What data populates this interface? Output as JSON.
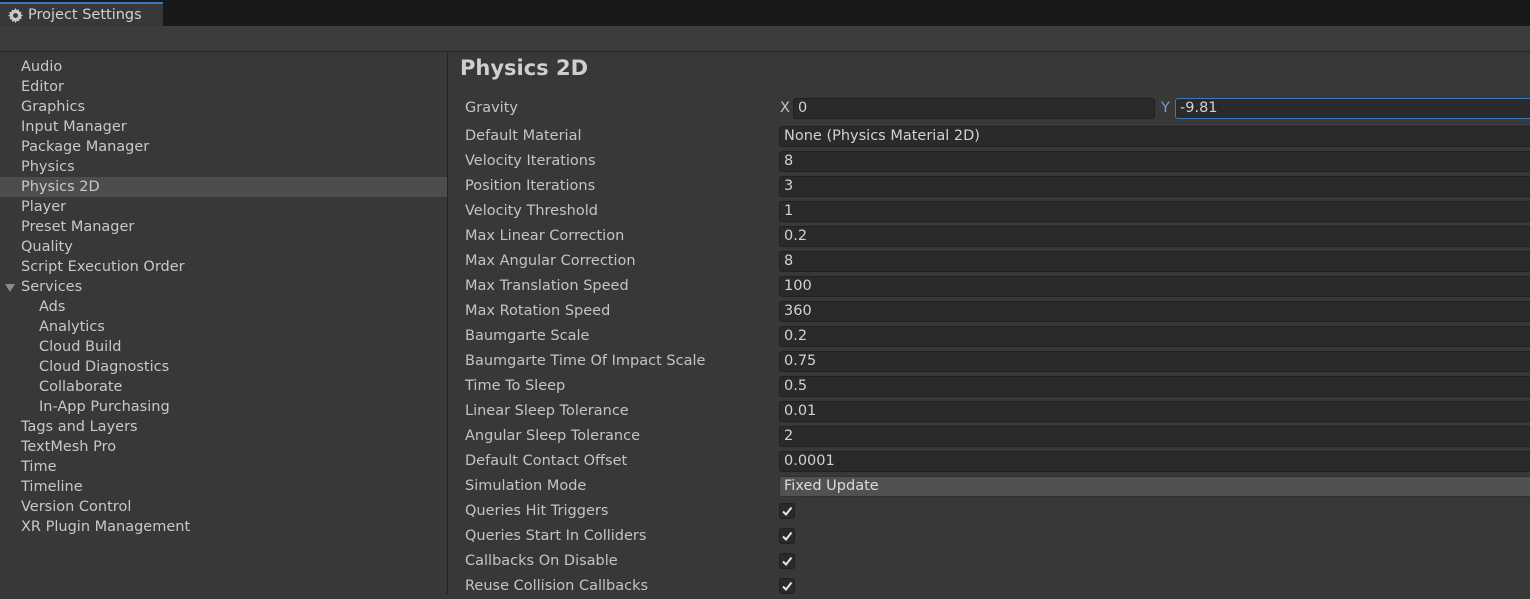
{
  "window": {
    "tab_title": "Project Settings",
    "tab_icon": "gear-icon"
  },
  "sidebar": {
    "items": [
      {
        "label": "Audio"
      },
      {
        "label": "Editor"
      },
      {
        "label": "Graphics"
      },
      {
        "label": "Input Manager"
      },
      {
        "label": "Package Manager"
      },
      {
        "label": "Physics"
      },
      {
        "label": "Physics 2D",
        "selected": true
      },
      {
        "label": "Player"
      },
      {
        "label": "Preset Manager"
      },
      {
        "label": "Quality"
      },
      {
        "label": "Script Execution Order"
      },
      {
        "label": "Services",
        "expanded": true
      },
      {
        "label": "Ads",
        "child": true
      },
      {
        "label": "Analytics",
        "child": true
      },
      {
        "label": "Cloud Build",
        "child": true
      },
      {
        "label": "Cloud Diagnostics",
        "child": true
      },
      {
        "label": "Collaborate",
        "child": true
      },
      {
        "label": "In-App Purchasing",
        "child": true
      },
      {
        "label": "Tags and Layers"
      },
      {
        "label": "TextMesh Pro"
      },
      {
        "label": "Time"
      },
      {
        "label": "Timeline"
      },
      {
        "label": "Version Control"
      },
      {
        "label": "XR Plugin Management"
      }
    ]
  },
  "main": {
    "title": "Physics 2D",
    "gravity": {
      "label": "Gravity",
      "x_label": "X",
      "x_value": "0",
      "y_label": "Y",
      "y_value": "-9.81"
    },
    "fields": [
      {
        "label": "Default Material",
        "value": "None (Physics Material 2D)",
        "kind": "object"
      },
      {
        "label": "Velocity Iterations",
        "value": "8",
        "kind": "number"
      },
      {
        "label": "Position Iterations",
        "value": "3",
        "kind": "number"
      },
      {
        "label": "Velocity Threshold",
        "value": "1",
        "kind": "number"
      },
      {
        "label": "Max Linear Correction",
        "value": "0.2",
        "kind": "number"
      },
      {
        "label": "Max Angular Correction",
        "value": "8",
        "kind": "number"
      },
      {
        "label": "Max Translation Speed",
        "value": "100",
        "kind": "number"
      },
      {
        "label": "Max Rotation Speed",
        "value": "360",
        "kind": "number"
      },
      {
        "label": "Baumgarte Scale",
        "value": "0.2",
        "kind": "number"
      },
      {
        "label": "Baumgarte Time Of Impact Scale",
        "value": "0.75",
        "kind": "number"
      },
      {
        "label": "Time To Sleep",
        "value": "0.5",
        "kind": "number"
      },
      {
        "label": "Linear Sleep Tolerance",
        "value": "0.01",
        "kind": "number"
      },
      {
        "label": "Angular Sleep Tolerance",
        "value": "2",
        "kind": "number"
      },
      {
        "label": "Default Contact Offset",
        "value": "0.0001",
        "kind": "number"
      },
      {
        "label": "Simulation Mode",
        "value": "Fixed Update",
        "kind": "dropdown"
      },
      {
        "label": "Queries Hit Triggers",
        "checked": true,
        "kind": "checkbox"
      },
      {
        "label": "Queries Start In Colliders",
        "checked": true,
        "kind": "checkbox"
      },
      {
        "label": "Callbacks On Disable",
        "checked": true,
        "kind": "checkbox"
      },
      {
        "label": "Reuse Collision Callbacks",
        "checked": true,
        "kind": "checkbox"
      }
    ]
  },
  "colors": {
    "accent": "#3a79bb",
    "y_axis_label": "#6fa0d8",
    "selected_row": "#4d4d4d",
    "background": "#383838"
  }
}
